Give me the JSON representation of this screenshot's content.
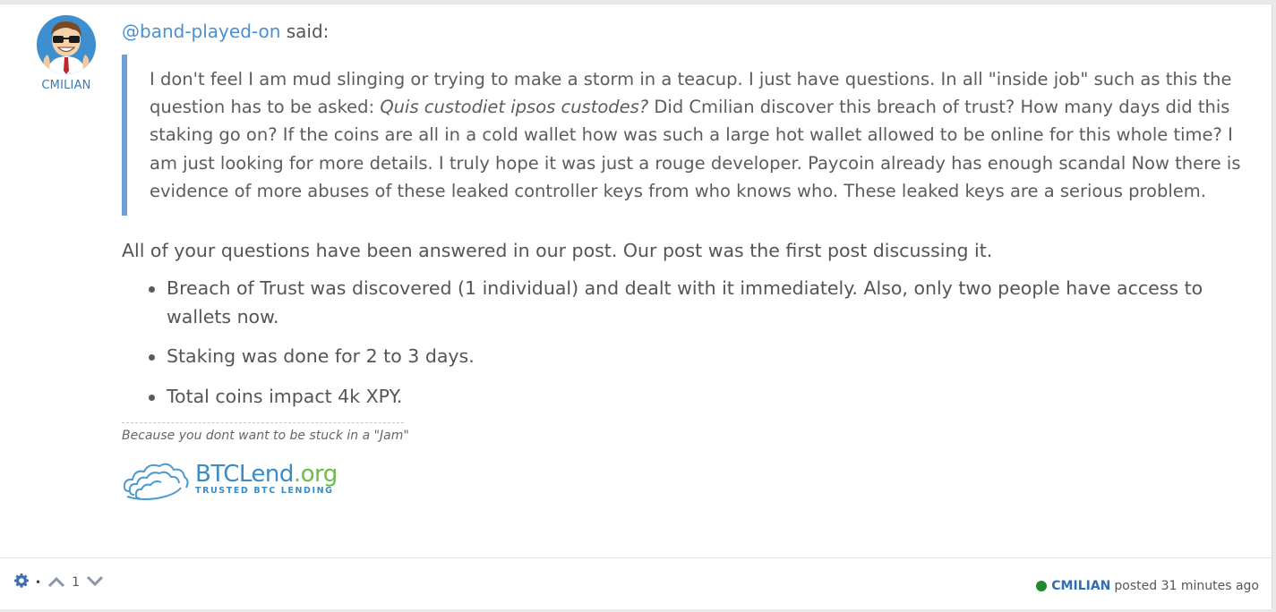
{
  "author": {
    "name": "CMILIAN"
  },
  "quote_header": {
    "mention": "@band-played-on",
    "said": " said:"
  },
  "quote": {
    "part1": "I don't feel I am mud slinging or trying to make a storm in a teacup. I just have questions. In all \"inside job\" such as this the question has to be asked: ",
    "italic": "Quis custodiet ipsos custodes?",
    "part2": " Did Cmilian discover this breach of trust? How many days did this staking go on? If the coins are all in a cold wallet how was such a large hot wallet allowed to be online for this whole time? I am just looking for more details. I truly hope it was just a rouge developer. Paycoin already has enough scandal Now there is evidence of more abuses of these leaked controller keys from who knows who. These leaked keys are a serious problem."
  },
  "answer": "All of your questions have been answered in our post. Our post was the first post discussing it.",
  "points": [
    "Breach of Trust was discovered (1 individual) and dealt with it immediately. Also, only two people have access to wallets now.",
    "Staking was done for 2 to 3 days.",
    "Total coins impact 4k XPY."
  ],
  "signature": {
    "text": "Because you dont want to be stuck in a \"Jam\"",
    "logo_main": "BTCLend",
    "logo_org": ".org",
    "logo_tagline": "TRUSTED BTC LENDING"
  },
  "footer": {
    "vote_count": "1",
    "author": "CMILIAN",
    "posted": "posted 31 minutes ago",
    "separator": "•"
  },
  "colors": {
    "accent": "#4a8fd0",
    "quote_border": "#6f9fdb",
    "online": "#1e8a2c"
  }
}
